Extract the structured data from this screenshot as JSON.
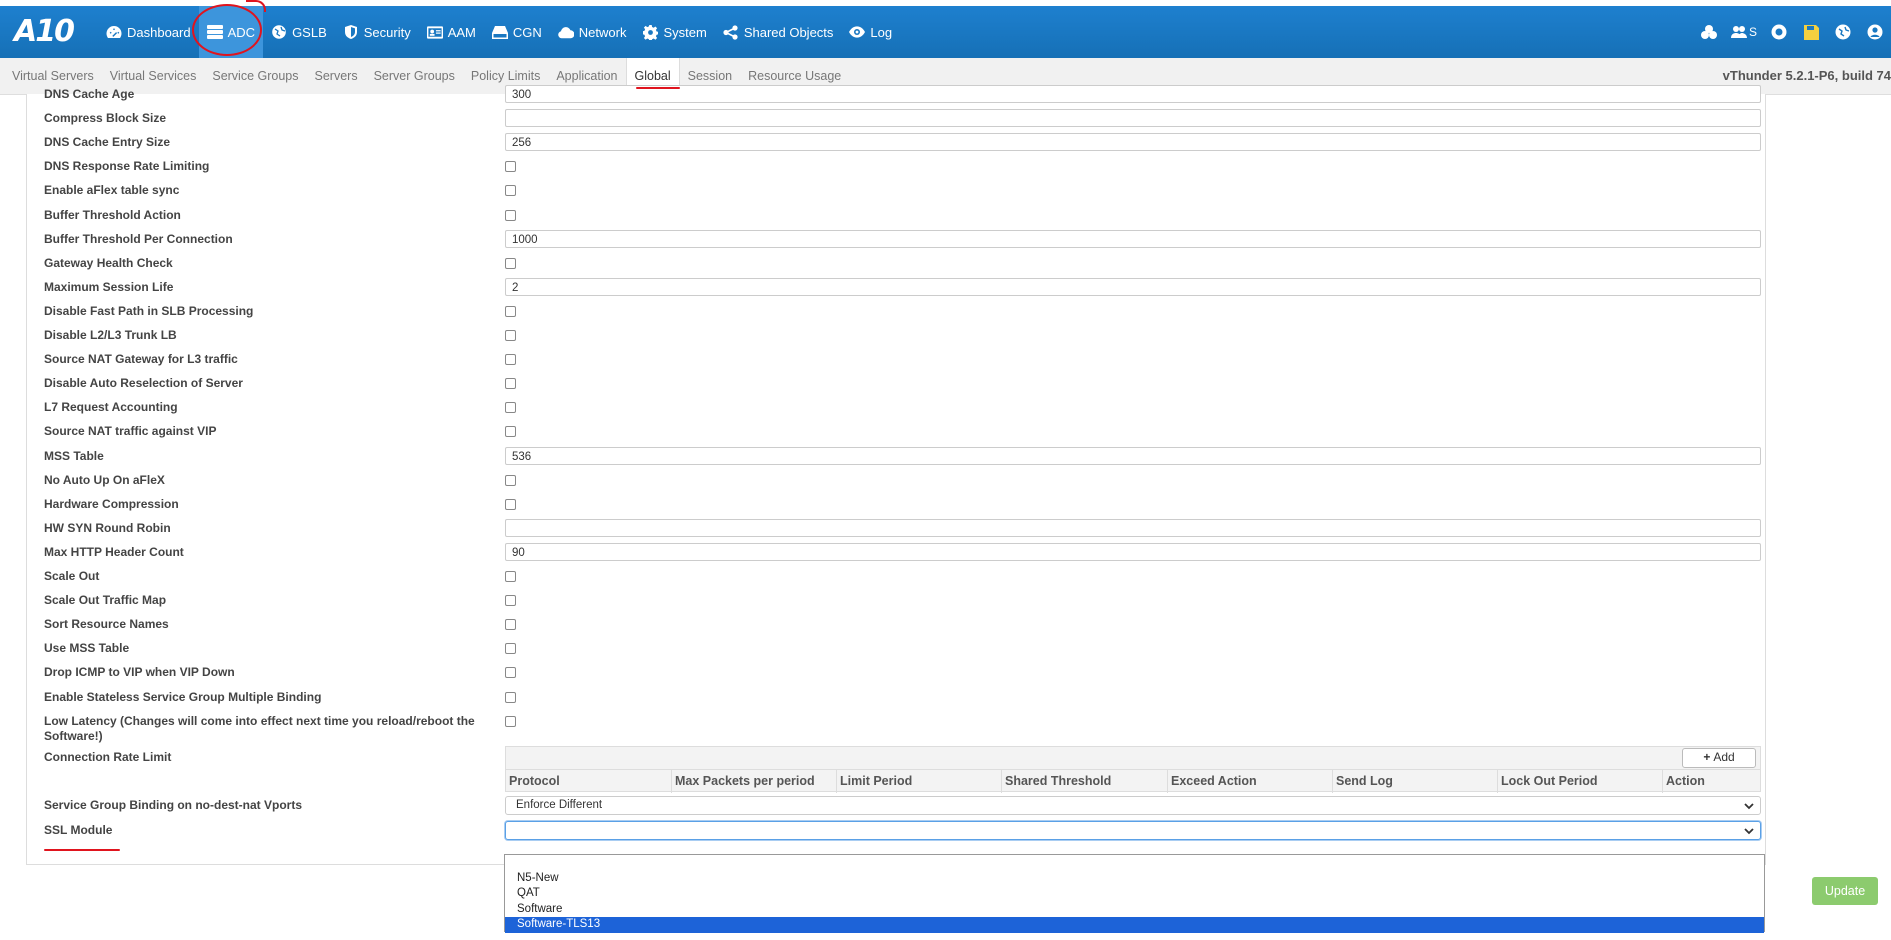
{
  "brand": {
    "logo": "A10"
  },
  "nav": [
    {
      "label": "Dashboard",
      "icon": "dashboard-icon"
    },
    {
      "label": "ADC",
      "icon": "server-icon",
      "active": true
    },
    {
      "label": "GSLB",
      "icon": "globe-icon"
    },
    {
      "label": "Security",
      "icon": "shield-icon"
    },
    {
      "label": "AAM",
      "icon": "id-card-icon"
    },
    {
      "label": "CGN",
      "icon": "hdd-icon"
    },
    {
      "label": "Network",
      "icon": "cloud-icon"
    },
    {
      "label": "System",
      "icon": "gear-icon"
    },
    {
      "label": "Shared Objects",
      "icon": "share-icon"
    },
    {
      "label": "Log",
      "icon": "eye-icon"
    }
  ],
  "top_right": {
    "user_label": "S"
  },
  "subnav": [
    "Virtual Servers",
    "Virtual Services",
    "Service Groups",
    "Servers",
    "Server Groups",
    "Policy Limits",
    "Application",
    "Global",
    "Session",
    "Resource Usage"
  ],
  "subnav_active": "Global",
  "version": "vThunder 5.2.1-P6, build 74",
  "form": {
    "fields": [
      {
        "label": "DNS Cache Age",
        "type": "text",
        "value": "300"
      },
      {
        "label": "Compress Block Size",
        "type": "text",
        "value": ""
      },
      {
        "label": "DNS Cache Entry Size",
        "type": "text",
        "value": "256"
      },
      {
        "label": "DNS Response Rate Limiting",
        "type": "checkbox"
      },
      {
        "label": "Enable aFlex table sync",
        "type": "checkbox"
      },
      {
        "label": "Buffer Threshold Action",
        "type": "checkbox"
      },
      {
        "label": "Buffer Threshold Per Connection",
        "type": "text",
        "value": "1000"
      },
      {
        "label": "Gateway Health Check",
        "type": "checkbox"
      },
      {
        "label": "Maximum Session Life",
        "type": "text",
        "value": "2"
      },
      {
        "label": "Disable Fast Path in SLB Processing",
        "type": "checkbox"
      },
      {
        "label": "Disable L2/L3 Trunk LB",
        "type": "checkbox"
      },
      {
        "label": "Source NAT Gateway for L3 traffic",
        "type": "checkbox"
      },
      {
        "label": "Disable Auto Reselection of Server",
        "type": "checkbox"
      },
      {
        "label": "L7 Request Accounting",
        "type": "checkbox"
      },
      {
        "label": "Source NAT traffic against VIP",
        "type": "checkbox"
      },
      {
        "label": "MSS Table",
        "type": "text",
        "value": "536"
      },
      {
        "label": "No Auto Up On aFleX",
        "type": "checkbox"
      },
      {
        "label": "Hardware Compression",
        "type": "checkbox"
      },
      {
        "label": "HW SYN Round Robin",
        "type": "text",
        "value": ""
      },
      {
        "label": "Max HTTP Header Count",
        "type": "text",
        "value": "90"
      },
      {
        "label": "Scale Out",
        "type": "checkbox"
      },
      {
        "label": "Scale Out Traffic Map",
        "type": "checkbox"
      },
      {
        "label": "Sort Resource Names",
        "type": "checkbox"
      },
      {
        "label": "Use MSS Table",
        "type": "checkbox"
      },
      {
        "label": "Drop ICMP to VIP when VIP Down",
        "type": "checkbox"
      },
      {
        "label": "Enable Stateless Service Group Multiple Binding",
        "type": "checkbox"
      },
      {
        "label": "Low Latency (Changes will come into effect next time you reload/reboot the Software!)",
        "type": "checkbox"
      }
    ],
    "connection_rate_limit": {
      "label": "Connection Rate Limit",
      "add_label": "Add",
      "columns": [
        "Protocol",
        "Max Packets per period",
        "Limit Period",
        "Shared Threshold",
        "Exceed Action",
        "Send Log",
        "Lock Out Period",
        "Action"
      ]
    },
    "service_group_binding": {
      "label": "Service Group Binding on no-dest-nat Vports",
      "value": "Enforce Different"
    },
    "ssl_module": {
      "label": "SSL Module",
      "value": "",
      "options": [
        "",
        "N5-New",
        "QAT",
        "Software",
        "Software-TLS13"
      ],
      "highlighted": "Software-TLS13"
    }
  },
  "update_label": "Update",
  "colors": {
    "topbar": "#1a78c2",
    "active_nav": "#3d95dc",
    "update": "#8ccb6e",
    "annotation": "#e0141e",
    "highlight": "#1d63d8"
  }
}
